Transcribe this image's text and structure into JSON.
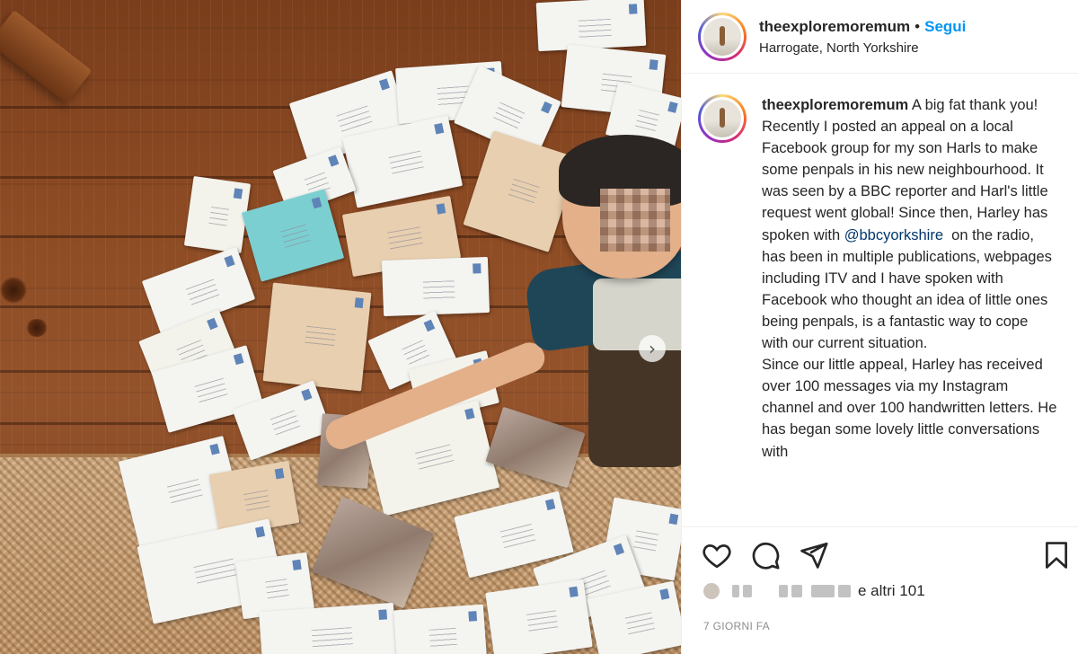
{
  "post": {
    "username": "theexploremoremum",
    "separator": "•",
    "follow_label": "Segui",
    "location": "Harrogate, North Yorkshire"
  },
  "caption": {
    "username": "theexploremoremum",
    "p1": "A big fat thank you!",
    "p2_a": "Recently I posted an appeal on a local Facebook group for my son Harls to make some penpals in his new neighbourhood. It was seen by a BBC reporter and Harl's little request went global! Since then, Harley has spoken with ",
    "mention": "@bbcyorkshire",
    "p2_b": "  on the radio, has been in multiple publications, webpages including ITV and I have spoken with Facebook who thought an idea of little ones being penpals, is a fantastic way to cope with our current situation.",
    "p3": "Since our little appeal, Harley has received over 100 messages via my Instagram channel and over 100 handwritten letters. He has began some lovely little conversations with"
  },
  "likes": {
    "text": "e altri 101"
  },
  "timestamp": "7 GIORNI FA",
  "icons": {
    "like": "heart-icon",
    "comment": "comment-icon",
    "share": "send-icon",
    "save": "bookmark-icon",
    "carousel_next": "chevron-right-icon"
  },
  "colors": {
    "accent": "#0095f6",
    "mention": "#00376b",
    "text": "#262626",
    "muted": "#8e8e8e"
  }
}
